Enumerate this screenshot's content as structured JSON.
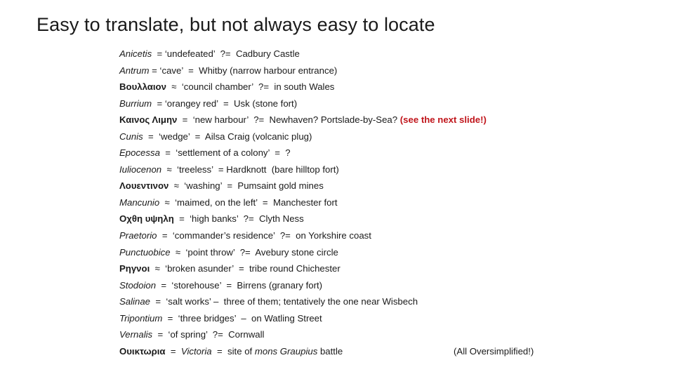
{
  "slide": {
    "title": "Easy to translate, but not always easy to locate",
    "accent_color": "#c0151b",
    "entries": [
      {
        "term": "Anicetis",
        "script": "latin",
        "rest": "  = ‘undefeated’  ?=  Cadbury Castle"
      },
      {
        "term": "Antrum",
        "script": "latin",
        "rest": " = ‘cave’  =  Whitby (narrow harbour entrance)"
      },
      {
        "term": "Βουλλαιον",
        "script": "greek",
        "rest": "  ≈  ‘council chamber’  ?=  in south Wales"
      },
      {
        "term": "Burrium",
        "script": "latin",
        "rest": "  = ‘orangey red’  =  Usk (stone fort)"
      },
      {
        "term": "Καινος Λιμην",
        "script": "greek",
        "rest": "  =  ‘new harbour’  ?=  Newhaven? Portslade-by-Sea? ",
        "note": "(see the next slide!)"
      },
      {
        "term": "Cunis",
        "script": "latin",
        "rest": "  =  ‘wedge’  =  Ailsa Craig (volcanic plug)"
      },
      {
        "term": "Epocessa",
        "script": "latin",
        "rest": "  =  ‘settlement of a colony’  =  ?"
      },
      {
        "term": "Iuliocenon",
        "script": "latin",
        "rest": "  ≈  ‘treeless’  = Hardknott  (bare hilltop fort)"
      },
      {
        "term": "Λουεντινον",
        "script": "greek",
        "rest": "  ≈  ‘washing’  =  Pumsaint gold mines"
      },
      {
        "term": "Mancunio",
        "script": "latin",
        "rest": "  ≈  ‘maimed, on the left’  =  Manchester fort"
      },
      {
        "term": "Οχθη υψηλη",
        "script": "greek",
        "rest": "  =  ‘high banks’  ?=  Clyth Ness"
      },
      {
        "term": "Praetorio",
        "script": "latin",
        "rest": "  =  ‘commander’s residence’  ?=  on Yorkshire coast"
      },
      {
        "term": "Punctuobice",
        "script": "latin",
        "rest": "  ≈  ‘point throw’  ?=  Avebury stone circle"
      },
      {
        "term": "Ρηγνοι",
        "script": "greek",
        "rest": "  ≈  ‘broken asunder’  =  tribe round Chichester"
      },
      {
        "term": "Stodoion",
        "script": "latin",
        "rest": "  =  ‘storehouse’  =  Birrens (granary fort)"
      },
      {
        "term": "Salinae",
        "script": "latin",
        "rest": "  =  ‘salt works’ –  three of them; tentatively the one near Wisbech"
      },
      {
        "term": "Tripontium",
        "script": "latin",
        "rest": "  =  ‘three bridges’  –  on Watling Street"
      },
      {
        "term": "Vernalis",
        "script": "latin",
        "rest": "  =  ‘of spring’  ?=  Cornwall"
      }
    ],
    "last_entry": {
      "term": "Ουικτωρια",
      "eq1": "  =  ",
      "latin_name": "Victoria",
      "eq2": "  =  site of ",
      "mons": "mons Graupius",
      "tail": " battle",
      "aside": "(All Oversimplified!)"
    }
  }
}
